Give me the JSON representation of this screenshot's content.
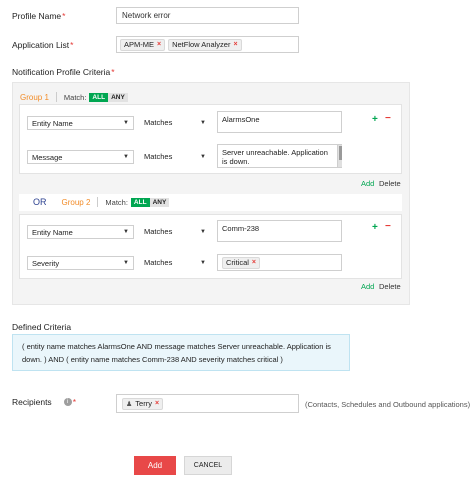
{
  "profile_name": {
    "label": "Profile Name",
    "value": "Network error"
  },
  "application_list": {
    "label": "Application List",
    "tags": [
      "APM-ME",
      "NetFlow Analyzer"
    ]
  },
  "criteria_label": "Notification Profile Criteria",
  "match_label": "Match:",
  "match_all": "ALL",
  "match_any": "ANY",
  "or_label": "OR",
  "group1": {
    "title": "Group 1",
    "rules": [
      {
        "field": "Entity Name",
        "operator": "Matches",
        "value": "AlarmsOne"
      },
      {
        "field": "Message",
        "operator": "Matches",
        "value": "Server unreachable. Application is down."
      }
    ]
  },
  "group2": {
    "title": "Group 2",
    "rules": [
      {
        "field": "Entity Name",
        "operator": "Matches",
        "value": "Comm-238"
      },
      {
        "field": "Severity",
        "operator": "Matches",
        "value": "Critical"
      }
    ]
  },
  "add_link": "Add",
  "delete_link": "Delete",
  "defined_criteria": {
    "label": "Defined Criteria",
    "text": "( entity name matches AlarmsOne AND message matches Server unreachable. Application is down. ) AND ( entity name matches Comm-238 AND severity matches critical )"
  },
  "recipients": {
    "label": "Recipients",
    "tags": [
      "Terry"
    ],
    "hint": "(Contacts, Schedules and Outbound applications)"
  },
  "buttons": {
    "add": "Add",
    "cancel": "CANCEL"
  },
  "colors": {
    "accent_green": "#00a651",
    "danger_red": "#e84848",
    "group_orange": "#f28c28",
    "criteria_bg": "#eaf6fb"
  }
}
